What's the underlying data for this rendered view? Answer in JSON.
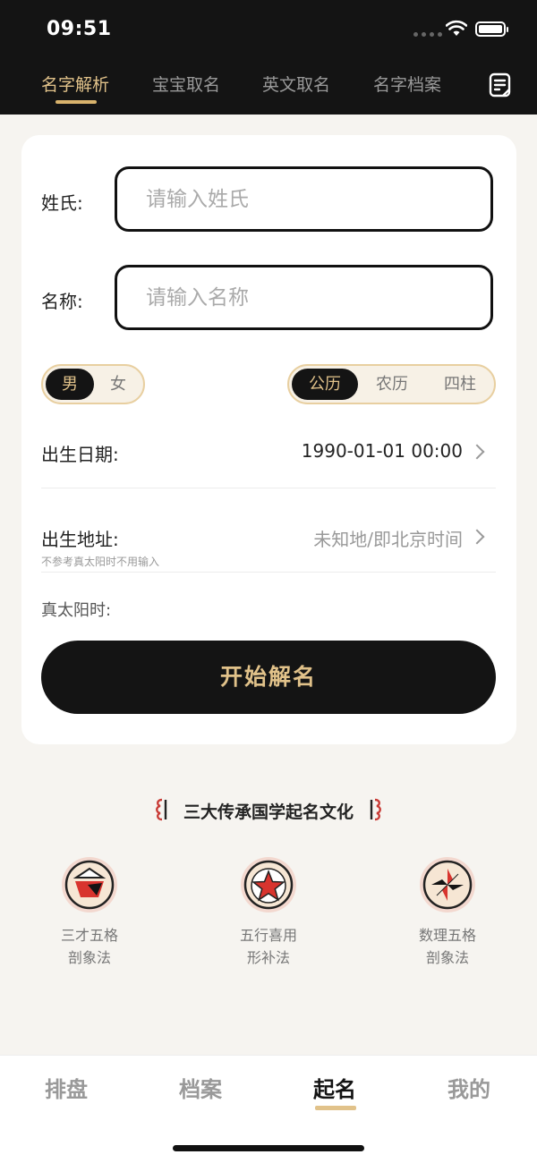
{
  "status": {
    "time": "09:51"
  },
  "top_tabs": [
    {
      "label": "名字解析",
      "active": true
    },
    {
      "label": "宝宝取名",
      "active": false
    },
    {
      "label": "英文取名",
      "active": false
    },
    {
      "label": "名字档案",
      "active": false
    }
  ],
  "form": {
    "surname_label": "姓氏:",
    "surname_placeholder": "请输入姓氏",
    "name_label": "名称:",
    "name_placeholder": "请输入名称",
    "gender": {
      "male": "男",
      "female": "女",
      "selected": "男"
    },
    "calendar": {
      "options": [
        "公历",
        "农历",
        "四柱"
      ],
      "selected": "公历"
    },
    "birth_date_label": "出生日期:",
    "birth_date_value": "1990-01-01 00:00",
    "birth_place_label": "出生地址:",
    "birth_place_value": "未知地/即北京时间",
    "birth_place_note": "不参考真太阳时不用输入",
    "true_solar_label": "真太阳时:",
    "start_button": "开始解名"
  },
  "culture": {
    "title": "三大传承国学起名文化",
    "methods": [
      {
        "line1": "三才五格",
        "line2": "剖象法",
        "icon": "sancai-medal-icon"
      },
      {
        "line1": "五行喜用",
        "line2": "形补法",
        "icon": "star-medal-icon"
      },
      {
        "line1": "数理五格",
        "line2": "剖象法",
        "icon": "pinwheel-medal-icon"
      }
    ]
  },
  "bottom_nav": [
    {
      "label": "排盘",
      "active": false
    },
    {
      "label": "档案",
      "active": false
    },
    {
      "label": "起名",
      "active": true
    },
    {
      "label": "我的",
      "active": false
    }
  ],
  "colors": {
    "accent": "#e1c28a",
    "dark": "#141414",
    "background": "#f6f4f0"
  }
}
